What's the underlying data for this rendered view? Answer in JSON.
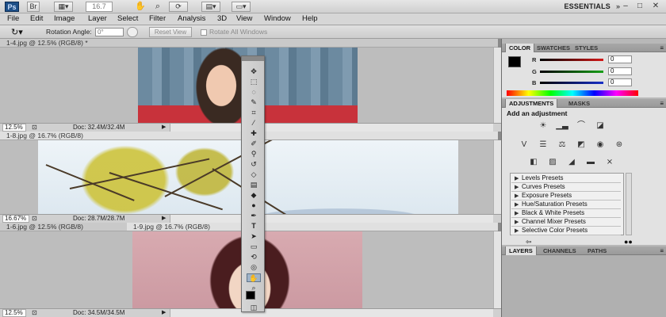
{
  "app": {
    "logo": "Ps",
    "workspace": "ESSENTIALS",
    "zoom_box": "16.7",
    "icons": [
      "bridge-icon",
      "view-extras-icon",
      "hand-icon",
      "zoom-icon",
      "rotate-view-icon",
      "arrange-documents-icon",
      "screen-mode-icon"
    ]
  },
  "menu": [
    "File",
    "Edit",
    "Image",
    "Layer",
    "Select",
    "Filter",
    "Analysis",
    "3D",
    "View",
    "Window",
    "Help"
  ],
  "options_bar": {
    "label": "Rotation Angle:",
    "angle_value": "0°",
    "reset_label": "Reset View",
    "rotate_all_label": "Rotate All Windows"
  },
  "documents": [
    {
      "tab": "1-4.jpg @ 12.5% (RGB/8) *",
      "zoom": "12.5%",
      "doc_size": "Doc: 32.4M/32.4M"
    },
    {
      "tab": "1-8.jpg @ 16.7% (RGB/8)",
      "zoom": "16.67%",
      "doc_size": "Doc: 28.7M/28.7M"
    },
    {
      "tab": "1-6.jpg @ 12.5% (RGB/8)",
      "tab2": "1-9.jpg @ 16.7% (RGB/8)",
      "zoom": "12.5%",
      "doc_size": "Doc: 34.5M/34.5M"
    }
  ],
  "panels": {
    "color": {
      "tabs": [
        "COLOR",
        "SWATCHES",
        "STYLES"
      ],
      "channels": [
        {
          "label": "R",
          "value": "0",
          "color": "#d41818"
        },
        {
          "label": "G",
          "value": "0",
          "color": "#18a018"
        },
        {
          "label": "B",
          "value": "0",
          "color": "#1830c8"
        }
      ]
    },
    "adjustments": {
      "tabs": [
        "ADJUSTMENTS",
        "MASKS"
      ],
      "heading": "Add an adjustment",
      "presets": [
        "Levels Presets",
        "Curves Presets",
        "Exposure Presets",
        "Hue/Saturation Presets",
        "Black & White Presets",
        "Channel Mixer Presets",
        "Selective Color Presets"
      ]
    },
    "layers": {
      "tabs": [
        "LAYERS",
        "CHANNELS",
        "PATHS"
      ]
    }
  },
  "colors": {
    "accent": "#1d4f88",
    "panel_bg": "#e2e2e2",
    "workspace_bg": "#bdbdbd"
  }
}
